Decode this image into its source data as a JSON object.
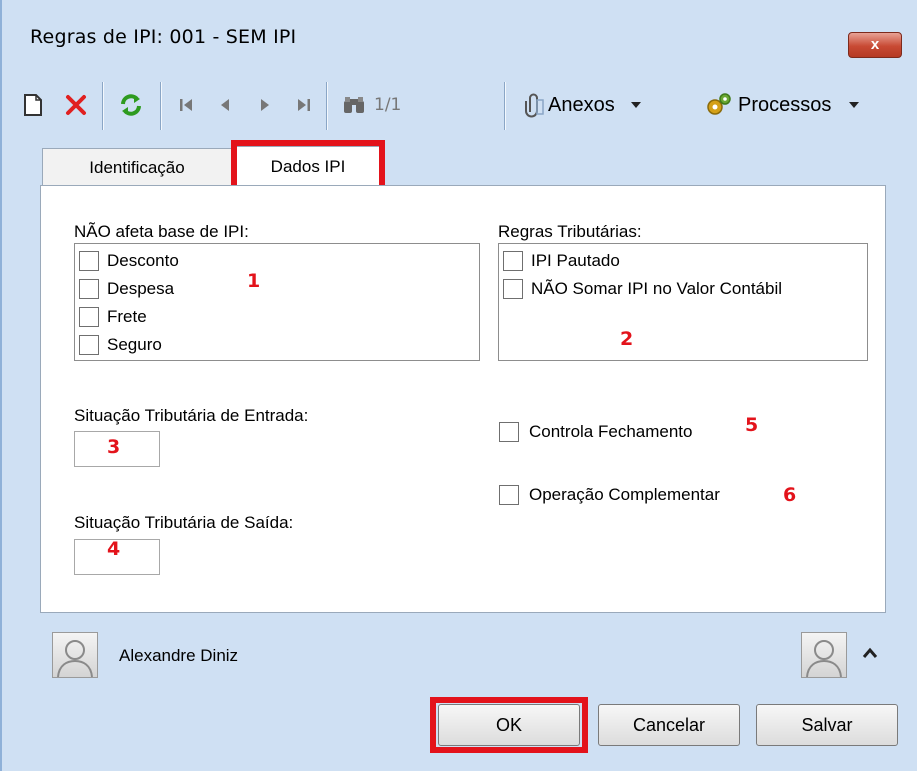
{
  "window": {
    "title": "Regras de IPI: 001 - SEM IPI",
    "close_glyph": "x"
  },
  "toolbar": {
    "counter": "1/1",
    "anexos_label": "Anexos",
    "processos_label": "Processos",
    "icons": [
      "new-document-icon",
      "delete-icon",
      "refresh-icon",
      "first-record-icon",
      "previous-record-icon",
      "next-record-icon",
      "last-record-icon",
      "binoculars-icon",
      "paperclip-icon",
      "gears-icon"
    ]
  },
  "tabs": [
    {
      "label": "Identificação",
      "active": false
    },
    {
      "label": "Dados IPI",
      "active": true
    }
  ],
  "base_ipi": {
    "label": "NÃO afeta base de IPI:",
    "items": [
      "Desconto",
      "Despesa",
      "Frete",
      "Seguro"
    ]
  },
  "regras": {
    "label": "Regras Tributárias:",
    "items": [
      "IPI Pautado",
      "NÃO Somar IPI no Valor Contábil"
    ]
  },
  "entrada": {
    "label": "Situação Tributária de Entrada:",
    "value": ""
  },
  "saida": {
    "label": "Situação Tributária de Saída:",
    "value": ""
  },
  "controla": {
    "label": "Controla Fechamento"
  },
  "operacao": {
    "label": "Operação Complementar"
  },
  "annotations": [
    "1",
    "2",
    "3",
    "4",
    "5",
    "6"
  ],
  "footer": {
    "user_name": "Alexandre Diniz",
    "expand_glyph": "^",
    "ok_label": "OK",
    "cancel_label": "Cancelar",
    "save_label": "Salvar"
  },
  "colors": {
    "highlight": "#e3131b",
    "window_bg": "#cfe0f3",
    "refresh_green": "#2e9b1f",
    "delete_red": "#e02020"
  }
}
